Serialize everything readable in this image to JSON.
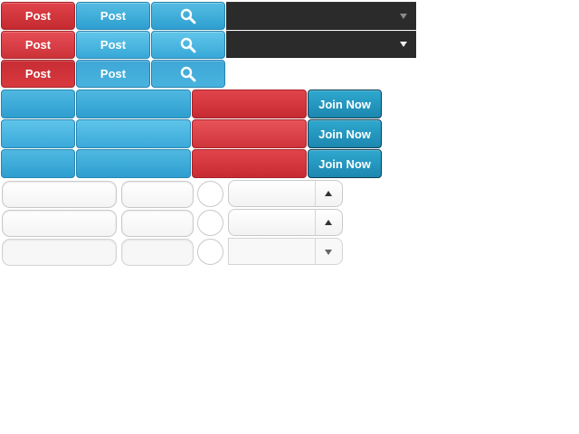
{
  "post_buttons": {
    "red_label": "Post",
    "blue_label": "Post"
  },
  "join_buttons": {
    "label": "Join Now"
  },
  "colors": {
    "red": "#d0343a",
    "blue": "#3aabd9",
    "dark": "#2b2b2b",
    "join": "#2496c0"
  },
  "icons": {
    "search": "search-icon",
    "select_dark": "triangle-down-icon",
    "select_light_up": "triangle-up-icon",
    "select_light_down": "triangle-down-icon"
  }
}
